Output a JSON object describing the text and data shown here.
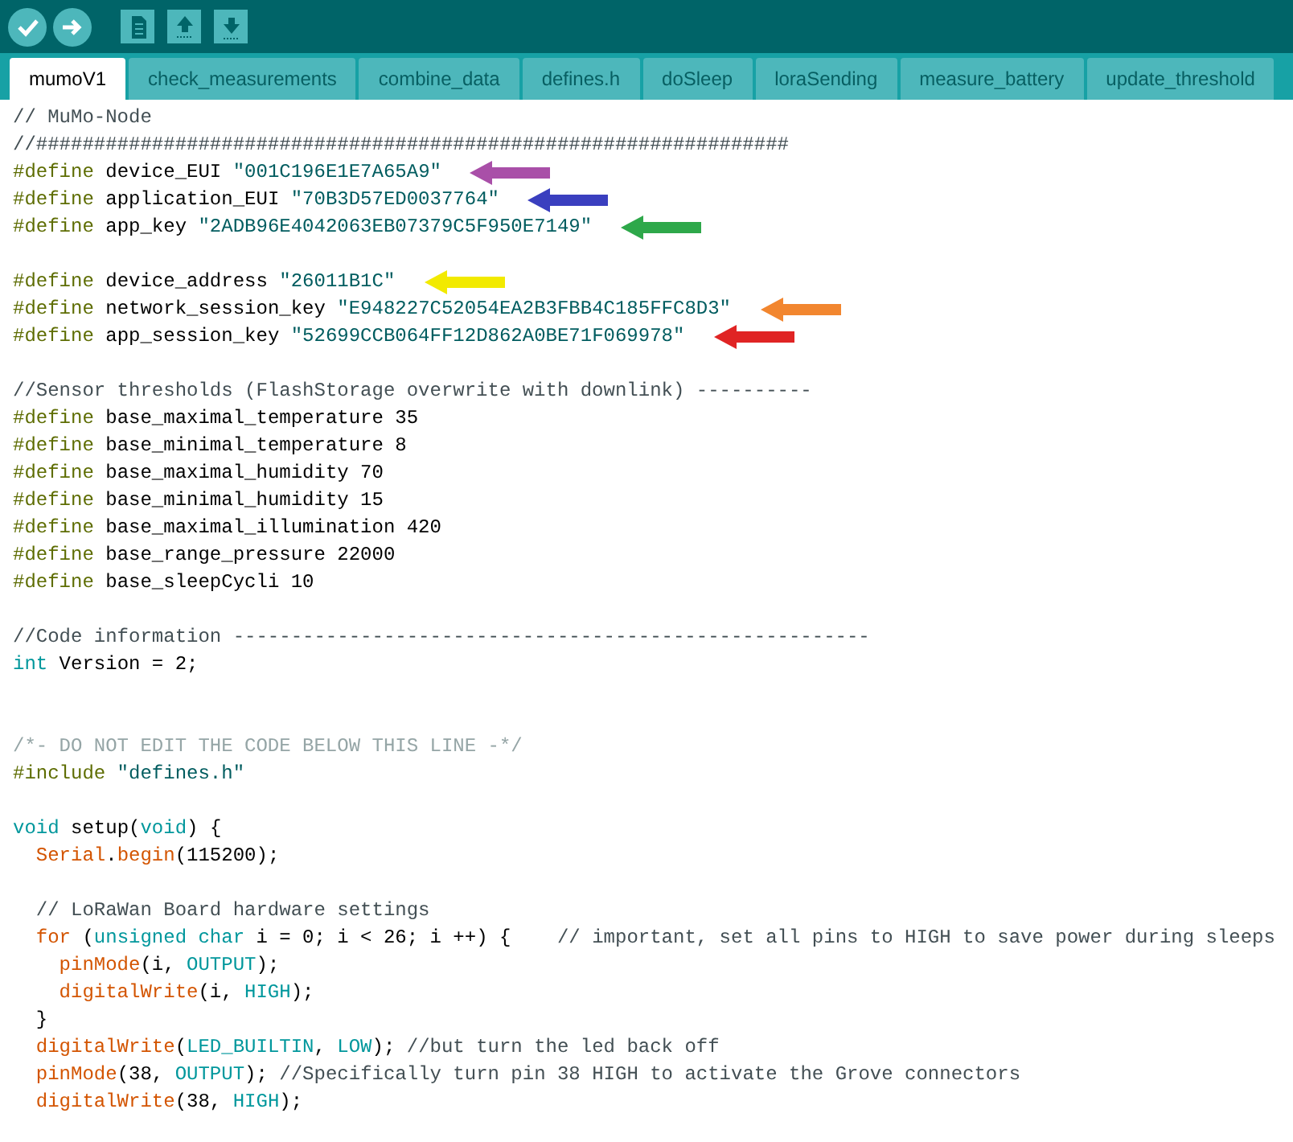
{
  "toolbar": [
    {
      "kind": "check"
    },
    {
      "kind": "right"
    },
    {
      "kind": "file"
    },
    {
      "kind": "up"
    },
    {
      "kind": "down"
    }
  ],
  "tabs": [
    {
      "label": "mumoV1",
      "selected": true
    },
    {
      "label": "check_measurements",
      "selected": false
    },
    {
      "label": "combine_data",
      "selected": false
    },
    {
      "label": "defines.h",
      "selected": false
    },
    {
      "label": "doSleep",
      "selected": false
    },
    {
      "label": "loraSending",
      "selected": false
    },
    {
      "label": "measure_battery",
      "selected": false
    },
    {
      "label": "update_threshold",
      "selected": false
    }
  ],
  "editor": {
    "lines": [
      {
        "kind": "code",
        "tokens": [
          {
            "kind": "comment",
            "text": "// MuMo-Node"
          }
        ]
      },
      {
        "kind": "code",
        "tokens": [
          {
            "kind": "comment",
            "text": "//#################################################################"
          }
        ]
      },
      {
        "kind": "code",
        "tokens": [
          {
            "kind": "directive",
            "text": "#define"
          },
          {
            "kind": "plain",
            "text": " device_EUI "
          },
          {
            "kind": "string",
            "text": "\"001C196E1E7A65A9\""
          }
        ],
        "arrow": {
          "color": "#a94fa8"
        }
      },
      {
        "kind": "code",
        "tokens": [
          {
            "kind": "directive",
            "text": "#define"
          },
          {
            "kind": "plain",
            "text": " application_EUI "
          },
          {
            "kind": "string",
            "text": "\"70B3D57ED0037764\""
          }
        ],
        "arrow": {
          "color": "#3a3fbf"
        }
      },
      {
        "kind": "code",
        "tokens": [
          {
            "kind": "directive",
            "text": "#define"
          },
          {
            "kind": "plain",
            "text": " app_key "
          },
          {
            "kind": "string",
            "text": "\"2ADB96E4042063EB07379C5F950E7149\""
          }
        ],
        "arrow": {
          "color": "#2ea84a"
        }
      },
      {
        "kind": "blank"
      },
      {
        "kind": "code",
        "tokens": [
          {
            "kind": "directive",
            "text": "#define"
          },
          {
            "kind": "plain",
            "text": " device_address "
          },
          {
            "kind": "string",
            "text": "\"26011B1C\""
          }
        ],
        "arrow": {
          "color": "#f2ea00"
        }
      },
      {
        "kind": "code",
        "tokens": [
          {
            "kind": "directive",
            "text": "#define"
          },
          {
            "kind": "plain",
            "text": " network_session_key "
          },
          {
            "kind": "string",
            "text": "\"E948227C52054EA2B3FBB4C185FFC8D3\""
          }
        ],
        "arrow": {
          "color": "#f2862f"
        }
      },
      {
        "kind": "code",
        "tokens": [
          {
            "kind": "directive",
            "text": "#define"
          },
          {
            "kind": "plain",
            "text": " app_session_key "
          },
          {
            "kind": "string",
            "text": "\"52699CCB064FF12D862A0BE71F069978\""
          }
        ],
        "arrow": {
          "color": "#e02424"
        }
      },
      {
        "kind": "blank"
      },
      {
        "kind": "code",
        "tokens": [
          {
            "kind": "comment",
            "text": "//Sensor thresholds (FlashStorage overwrite with downlink) ----------"
          }
        ]
      },
      {
        "kind": "code",
        "tokens": [
          {
            "kind": "directive",
            "text": "#define"
          },
          {
            "kind": "plain",
            "text": " base_maximal_temperature 35"
          }
        ]
      },
      {
        "kind": "code",
        "tokens": [
          {
            "kind": "directive",
            "text": "#define"
          },
          {
            "kind": "plain",
            "text": " base_minimal_temperature 8"
          }
        ]
      },
      {
        "kind": "code",
        "tokens": [
          {
            "kind": "directive",
            "text": "#define"
          },
          {
            "kind": "plain",
            "text": " base_maximal_humidity 70"
          }
        ]
      },
      {
        "kind": "code",
        "tokens": [
          {
            "kind": "directive",
            "text": "#define"
          },
          {
            "kind": "plain",
            "text": " base_minimal_humidity 15"
          }
        ]
      },
      {
        "kind": "code",
        "tokens": [
          {
            "kind": "directive",
            "text": "#define"
          },
          {
            "kind": "plain",
            "text": " base_maximal_illumination 420"
          }
        ]
      },
      {
        "kind": "code",
        "tokens": [
          {
            "kind": "directive",
            "text": "#define"
          },
          {
            "kind": "plain",
            "text": " base_range_pressure 22000"
          }
        ]
      },
      {
        "kind": "code",
        "tokens": [
          {
            "kind": "directive",
            "text": "#define"
          },
          {
            "kind": "plain",
            "text": " base_sleepCycli 10"
          }
        ]
      },
      {
        "kind": "blank"
      },
      {
        "kind": "code",
        "tokens": [
          {
            "kind": "comment",
            "text": "//Code information -------------------------------------------------------"
          }
        ]
      },
      {
        "kind": "code",
        "tokens": [
          {
            "kind": "keyword",
            "text": "int"
          },
          {
            "kind": "plain",
            "text": " Version = 2;"
          }
        ]
      },
      {
        "kind": "blank"
      },
      {
        "kind": "blank"
      },
      {
        "kind": "code",
        "tokens": [
          {
            "kind": "blockcomment",
            "text": "/*- DO NOT EDIT THE CODE BELOW THIS LINE -*/"
          }
        ]
      },
      {
        "kind": "code",
        "tokens": [
          {
            "kind": "directive",
            "text": "#include"
          },
          {
            "kind": "string",
            "text": " \"defines.h\""
          }
        ]
      },
      {
        "kind": "blank"
      },
      {
        "kind": "code",
        "tokens": [
          {
            "kind": "keyword",
            "text": "void"
          },
          {
            "kind": "plain",
            "text": " setup("
          },
          {
            "kind": "keyword",
            "text": "void"
          },
          {
            "kind": "plain",
            "text": ") {"
          }
        ]
      },
      {
        "kind": "code",
        "tokens": [
          {
            "kind": "function",
            "text": "  Serial"
          },
          {
            "kind": "plain",
            "text": "."
          },
          {
            "kind": "function",
            "text": "begin"
          },
          {
            "kind": "plain",
            "text": "(115200);"
          }
        ]
      },
      {
        "kind": "blank"
      },
      {
        "kind": "code",
        "tokens": [
          {
            "kind": "comment",
            "text": "  // LoRaWan Board hardware settings"
          }
        ]
      },
      {
        "kind": "code",
        "tokens": [
          {
            "kind": "function",
            "text": "  for"
          },
          {
            "kind": "plain",
            "text": " ("
          },
          {
            "kind": "keyword",
            "text": "unsigned char"
          },
          {
            "kind": "plain",
            "text": " i = 0; i < 26; i ++) {    "
          },
          {
            "kind": "comment",
            "text": "// important, set all pins to HIGH to save power during sleeps"
          }
        ]
      },
      {
        "kind": "code",
        "tokens": [
          {
            "kind": "function",
            "text": "    pinMode"
          },
          {
            "kind": "plain",
            "text": "(i, "
          },
          {
            "kind": "keyword",
            "text": "OUTPUT"
          },
          {
            "kind": "plain",
            "text": ");"
          }
        ]
      },
      {
        "kind": "code",
        "tokens": [
          {
            "kind": "function",
            "text": "    digitalWrite"
          },
          {
            "kind": "plain",
            "text": "(i, "
          },
          {
            "kind": "keyword",
            "text": "HIGH"
          },
          {
            "kind": "plain",
            "text": ");"
          }
        ]
      },
      {
        "kind": "code",
        "tokens": [
          {
            "kind": "plain",
            "text": "  }"
          }
        ]
      },
      {
        "kind": "code",
        "tokens": [
          {
            "kind": "function",
            "text": "  digitalWrite"
          },
          {
            "kind": "plain",
            "text": "("
          },
          {
            "kind": "keyword",
            "text": "LED_BUILTIN"
          },
          {
            "kind": "plain",
            "text": ", "
          },
          {
            "kind": "keyword",
            "text": "LOW"
          },
          {
            "kind": "plain",
            "text": "); "
          },
          {
            "kind": "comment",
            "text": "//but turn the led back off"
          }
        ]
      },
      {
        "kind": "code",
        "tokens": [
          {
            "kind": "function",
            "text": "  pinMode"
          },
          {
            "kind": "plain",
            "text": "(38, "
          },
          {
            "kind": "keyword",
            "text": "OUTPUT"
          },
          {
            "kind": "plain",
            "text": "); "
          },
          {
            "kind": "comment",
            "text": "//Specifically turn pin 38 HIGH to activate the Grove connectors"
          }
        ]
      },
      {
        "kind": "code",
        "tokens": [
          {
            "kind": "function",
            "text": "  digitalWrite"
          },
          {
            "kind": "plain",
            "text": "(38, "
          },
          {
            "kind": "keyword",
            "text": "HIGH"
          },
          {
            "kind": "plain",
            "text": ");"
          }
        ]
      }
    ]
  }
}
